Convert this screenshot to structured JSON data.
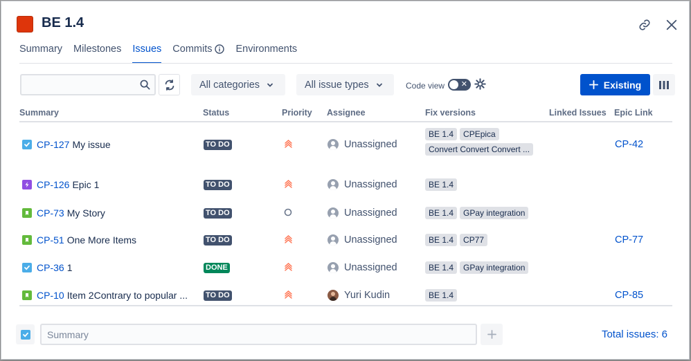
{
  "header": {
    "title": "BE 1.4",
    "color": "#de350b",
    "link_icon": "link-icon",
    "close_icon": "close-icon"
  },
  "tabs": [
    {
      "label": "Summary",
      "active": false
    },
    {
      "label": "Milestones",
      "active": false
    },
    {
      "label": "Issues",
      "active": true
    },
    {
      "label": "Commits",
      "active": false,
      "info_icon": true
    },
    {
      "label": "Environments",
      "active": false
    }
  ],
  "toolbar": {
    "search_placeholder": "",
    "search_value": "",
    "categories_label": "All categories",
    "issue_types_label": "All issue types",
    "code_view_label": "Code view",
    "code_view_on": false,
    "existing_label": "Existing"
  },
  "columns": [
    "Summary",
    "Status",
    "Priority",
    "Assignee",
    "Fix versions",
    "Linked Issues",
    "Epic Link"
  ],
  "rows": [
    {
      "type": "task",
      "key": "CP-127",
      "summary": "My issue",
      "status": "TO DO",
      "priority": "highest",
      "assignee": "Unassigned",
      "fix_versions": [
        "BE 1.4",
        "CPEpica",
        "Convert Convert Convert ..."
      ],
      "linked": "",
      "epic": "CP-42"
    },
    {
      "type": "epic",
      "key": "CP-126",
      "summary": "Epic 1",
      "status": "TO DO",
      "priority": "highest",
      "assignee": "Unassigned",
      "fix_versions": [
        "BE 1.4"
      ],
      "linked": "",
      "epic": ""
    },
    {
      "type": "story",
      "key": "CP-73",
      "summary": "My Story",
      "status": "TO DO",
      "priority": "none",
      "assignee": "Unassigned",
      "fix_versions": [
        "BE 1.4",
        "GPay integration"
      ],
      "linked": "",
      "epic": ""
    },
    {
      "type": "story",
      "key": "CP-51",
      "summary": "One More Items",
      "status": "TO DO",
      "priority": "highest",
      "assignee": "Unassigned",
      "fix_versions": [
        "BE 1.4",
        "CP77"
      ],
      "linked": "",
      "epic": "CP-77"
    },
    {
      "type": "task",
      "key": "CP-36",
      "summary": "1",
      "status": "DONE",
      "priority": "highest",
      "assignee": "Unassigned",
      "fix_versions": [
        "BE 1.4",
        "GPay integration"
      ],
      "linked": "",
      "epic": ""
    },
    {
      "type": "story",
      "key": "CP-10",
      "summary": "Item 2Contrary to popular ...",
      "status": "TO DO",
      "priority": "highest",
      "assignee": "Yuri Kudin",
      "fix_versions": [
        "BE 1.4"
      ],
      "linked": "",
      "epic": "CP-85"
    }
  ],
  "footer": {
    "summary_placeholder": "Summary",
    "total_label": "Total issues: 6"
  },
  "colors": {
    "task": "#4bade8",
    "epic": "#904ee2",
    "story": "#63ba3c",
    "todo": "#42526e",
    "done": "#00875a",
    "priority": "#ff7452",
    "accent": "#0052cc"
  }
}
